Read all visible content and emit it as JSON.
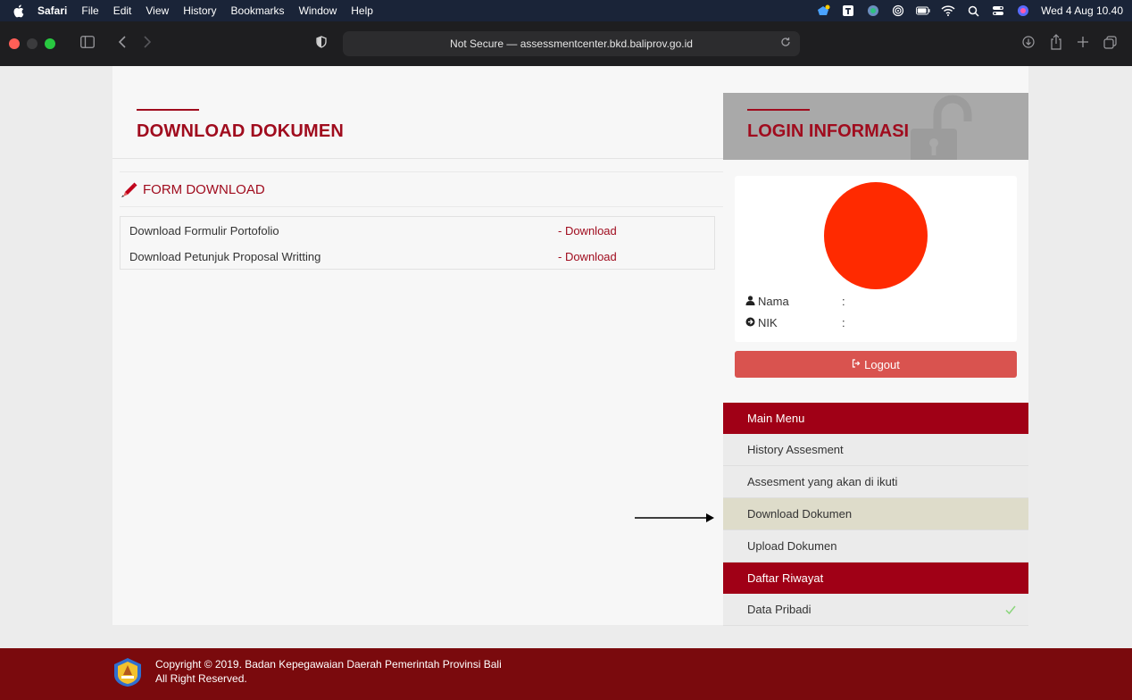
{
  "menubar": {
    "app": "Safari",
    "items": [
      "File",
      "Edit",
      "View",
      "History",
      "Bookmarks",
      "Window",
      "Help"
    ],
    "clock": "Wed 4 Aug  10.40"
  },
  "browser": {
    "url_text": "Not Secure — assessmentcenter.bkd.baliprov.go.id"
  },
  "main": {
    "heading": "DOWNLOAD DOKUMEN",
    "form_title": "FORM DOWNLOAD",
    "rows": [
      {
        "label": "Download Formulir Portofolio",
        "link": "- Download"
      },
      {
        "label": "Download Petunjuk Proposal Writting",
        "link": "- Download"
      }
    ]
  },
  "login": {
    "heading": "LOGIN INFORMASI",
    "nama_label": "Nama",
    "nik_label": "NIK",
    "colon": ":",
    "logout": "Logout",
    "avatar_color": "#ff2a00"
  },
  "menu": {
    "main_head": "Main Menu",
    "items": [
      "History Assesment",
      "Assesment yang akan di ikuti",
      "Download Dokumen",
      "Upload Dokumen"
    ],
    "daftar_head": "Daftar Riwayat",
    "daftar_items": [
      "Data Pribadi"
    ]
  },
  "footer": {
    "line1": "Copyright © 2019. Badan Kepegawaian Daerah Pemerintah Provinsi Bali",
    "line2": "All Right Reserved."
  },
  "colors": {
    "accent": "#a00c1e",
    "menu_head": "#a00016",
    "footer": "#7a0a0d",
    "logout": "#d9534f"
  }
}
